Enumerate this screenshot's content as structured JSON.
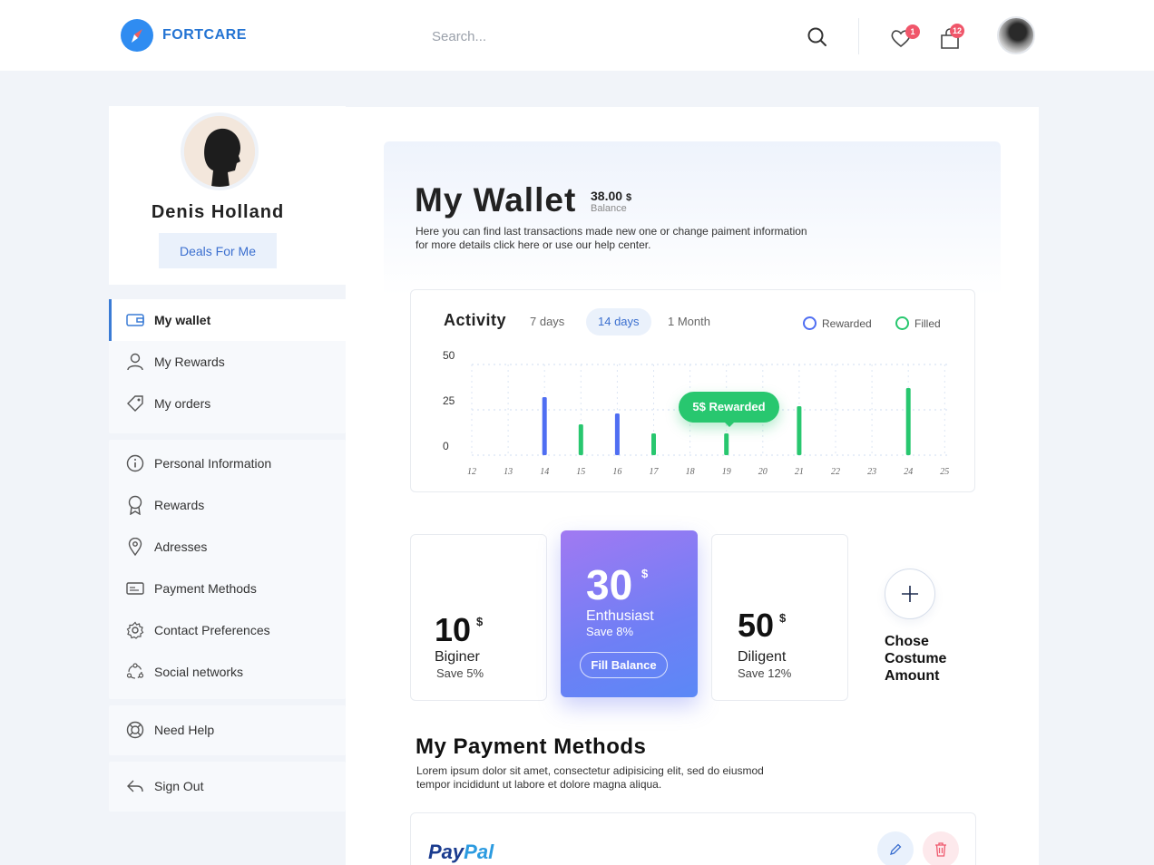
{
  "header": {
    "brand": "FORTCARE",
    "search_placeholder": "Search...",
    "wishlist_count": "1",
    "cart_count": "12"
  },
  "profile": {
    "name": "Denis Holland",
    "deals_label": "Deals For Me"
  },
  "menu": {
    "group1": [
      {
        "label": "My wallet",
        "icon": "wallet-icon",
        "active": true
      },
      {
        "label": "My Rewards",
        "icon": "user-icon"
      },
      {
        "label": "My orders",
        "icon": "tag-icon"
      }
    ],
    "group2": [
      {
        "label": "Personal Information",
        "icon": "info-icon"
      },
      {
        "label": "Rewards",
        "icon": "award-icon"
      },
      {
        "label": "Adresses",
        "icon": "location-pin-icon"
      },
      {
        "label": "Payment Methods",
        "icon": "card-icon"
      },
      {
        "label": "Contact Preferences",
        "icon": "gear-icon"
      },
      {
        "label": "Social networks",
        "icon": "network-icon"
      }
    ],
    "help": {
      "label": "Need Help",
      "icon": "lifebuoy-icon"
    },
    "signout": {
      "label": "Sign Out",
      "icon": "sign-out-icon"
    }
  },
  "wallet": {
    "title": "My Wallet",
    "balance_value": "38.00",
    "balance_currency": "$",
    "balance_label": "Balance",
    "description_line1": "Here you can find last transactions made new one or change paiment information",
    "description_line2": "for more details click here or use our help center."
  },
  "activity": {
    "title": "Activity",
    "tabs": [
      "7 days",
      "14 days",
      "1 Month"
    ],
    "active_tab": "14 days",
    "legend": [
      {
        "label": "Rewarded",
        "color": "#4f6ef2"
      },
      {
        "label": "Filled",
        "color": "#28c76f"
      }
    ],
    "tooltip": "5$ Rewarded"
  },
  "chart_data": {
    "type": "bar",
    "categories": [
      "12",
      "13",
      "14",
      "15",
      "16",
      "17",
      "18",
      "19",
      "20",
      "21",
      "22",
      "23",
      "24",
      "25"
    ],
    "series": [
      {
        "name": "Rewarded",
        "color": "#4f6ef2",
        "values": [
          0,
          0,
          32,
          0,
          23,
          0,
          0,
          0,
          0,
          0,
          0,
          0,
          0,
          0
        ]
      },
      {
        "name": "Filled",
        "color": "#28c76f",
        "values": [
          0,
          0,
          0,
          17,
          0,
          12,
          0,
          12,
          0,
          27,
          0,
          0,
          37,
          0
        ]
      }
    ],
    "yticks": [
      0,
      25,
      50
    ],
    "ylim": [
      0,
      50
    ],
    "grid": true
  },
  "plans": [
    {
      "amount": "10",
      "currency": "$",
      "name": "Biginer",
      "save": "Save 5%"
    },
    {
      "amount": "30",
      "currency": "$",
      "name": "Enthusiast",
      "save": "Save 8%",
      "button": "Fill Balance"
    },
    {
      "amount": "50",
      "currency": "$",
      "name": "Diligent",
      "save": "Save 12%"
    }
  ],
  "custom_amount": {
    "line1": "Chose",
    "line2": "Costume",
    "line3": "Amount"
  },
  "payment_methods": {
    "title": "My Payment Methods",
    "desc_line1": "Lorem ipsum dolor sit amet, consectetur adipisicing elit, sed do eiusmod",
    "desc_line2": "tempor incididunt ut labore et dolore magna aliqua.",
    "items": [
      {
        "brand_part1": "Pay",
        "brand_part2": "Pal"
      }
    ]
  }
}
